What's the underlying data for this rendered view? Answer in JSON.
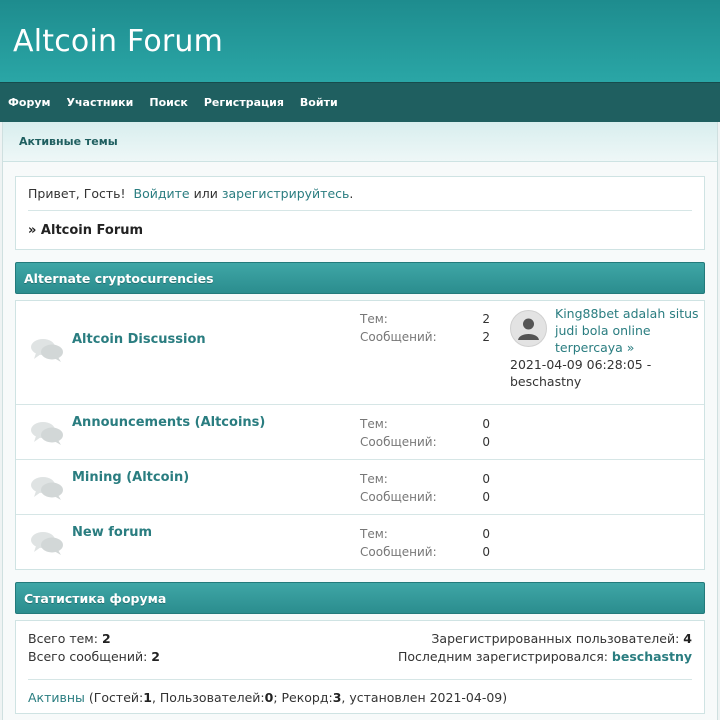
{
  "site": {
    "title": "Altcoin Forum"
  },
  "nav": [
    "Форум",
    "Участники",
    "Поиск",
    "Регистрация",
    "Войти"
  ],
  "subnav": {
    "active_topics": "Активные темы"
  },
  "welcome": {
    "greeting": "Привет, Гость!",
    "login_link": "Войдите",
    "or": "или",
    "register_link": "зарегистрируйтесь",
    "period": ".",
    "breadcrumb": "» Altcoin Forum"
  },
  "category": {
    "title": "Alternate cryptocurrencies"
  },
  "boards": [
    {
      "name": "Altcoin Discussion",
      "topics_label": "Тем:",
      "topics": "2",
      "posts_label": "Сообщений:",
      "posts": "2",
      "last_post": {
        "title": "King88bet adalah situs judi bola online terpercaya",
        "arrow": "»",
        "date": "2021-04-09 06:28:05 -",
        "author": "beschastny"
      }
    },
    {
      "name": "Announcements (Altcoins)",
      "topics_label": "Тем:",
      "topics": "0",
      "posts_label": "Сообщений:",
      "posts": "0"
    },
    {
      "name": "Mining (Altcoin)",
      "topics_label": "Тем:",
      "topics": "0",
      "posts_label": "Сообщений:",
      "posts": "0"
    },
    {
      "name": "New forum",
      "topics_label": "Тем:",
      "topics": "0",
      "posts_label": "Сообщений:",
      "posts": "0"
    }
  ],
  "forum_stats": {
    "title": "Статистика форума",
    "total_topics_label": "Всего тем:",
    "total_topics": "2",
    "total_posts_label": "Всего сообщений:",
    "total_posts": "2",
    "registered_label": "Зарегистрированных пользователей:",
    "registered": "4",
    "last_registered_label": "Последним зарегистрировался:",
    "last_registered": "beschastny",
    "active_link": "Активны",
    "online_prefix": "(Гостей: ",
    "guests": "1",
    "users_label": ", Пользователей: ",
    "users": "0",
    "record_label": "; Рекорд: ",
    "record": "3",
    "record_suffix": ", установлен 2021-04-09)"
  },
  "colors": {
    "header": "#2aa6a6",
    "nav": "#1f5f60",
    "link": "#2a7d80"
  },
  "icons": {
    "board": "speech-bubbles-icon",
    "avatar": "user-silhouette-icon"
  }
}
